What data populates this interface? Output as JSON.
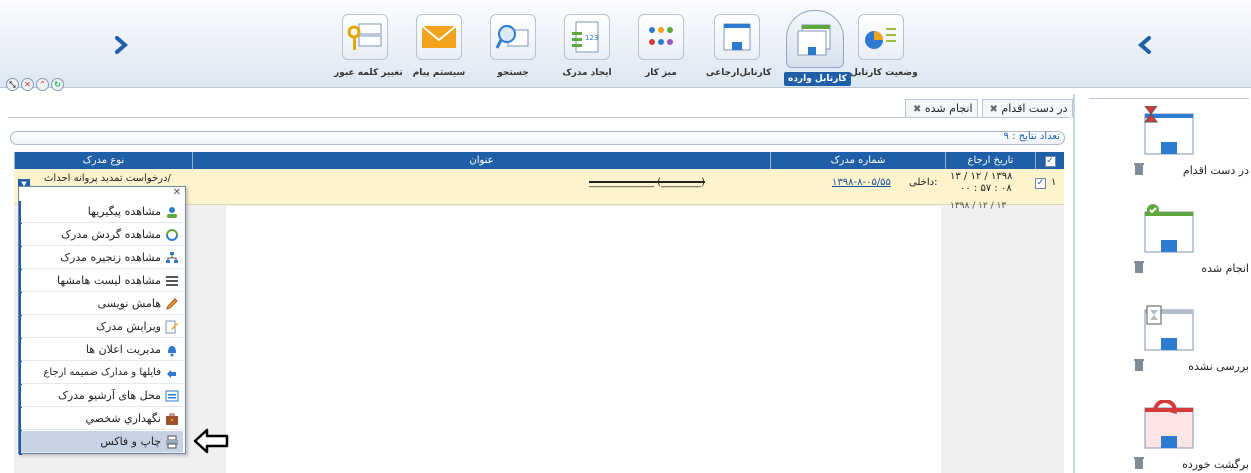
{
  "toolbar": {
    "tools": [
      {
        "id": "workbox-status",
        "label": "وضعیت کارتابل"
      },
      {
        "id": "inbox",
        "label": "کارتابل وارده"
      },
      {
        "id": "referral",
        "label": "کارتابل‌ارجاعی"
      },
      {
        "id": "desk",
        "label": "میز کار"
      },
      {
        "id": "create-doc",
        "label": "ایجاد مدرک"
      },
      {
        "id": "search",
        "label": "جستجو"
      },
      {
        "id": "messages",
        "label": "سیستم پیام"
      },
      {
        "id": "change-password",
        "label": "تغییر کلمه عبور"
      }
    ]
  },
  "sidebar": {
    "folders": [
      {
        "label": "در دست اقدام"
      },
      {
        "label": "انجام شده"
      },
      {
        "label": "بررسی نشده"
      },
      {
        "label": "برگشت خورده"
      }
    ]
  },
  "tabs": [
    {
      "label": "در دست اقدام"
    },
    {
      "label": "انجام شده"
    }
  ],
  "results": {
    "text": "تعداد نتایج : ۹"
  },
  "grid": {
    "headers": {
      "referral_date": "تاریخ ارجاع",
      "doc_number": "شماره مدرک",
      "title": "عنوان",
      "doc_type": "نوع مدرک"
    },
    "rows": [
      {
        "index": "۱",
        "date_line1": "۱۳۹۸ / ۱۲ / ۱۳",
        "date_line2": "۰۸ : ۵۷ : ۰۰",
        "doc_prefix": "داخلی:",
        "doc_number": "۱۳۹۸-۸-۰۵/۵۵",
        "title": "_____________ (________)",
        "doc_type": "درخواست تمدید پروانه احداث/"
      },
      {
        "date_line1": "۱۳۹۸ / ۱۲ / ۱۳"
      }
    ]
  },
  "context_menu": {
    "items": [
      {
        "label": "مشاهده پیگیریها"
      },
      {
        "label": "مشاهده گردش مدرک"
      },
      {
        "label": "مشاهده زنجیره مدرک"
      },
      {
        "label": "مشاهده لیست هامشها"
      },
      {
        "label": "هامش نویسی"
      },
      {
        "label": "ویرایش مدرک"
      },
      {
        "label": "مدیریت اعلان ها"
      },
      {
        "label": "فایلها و مدارک ضمیمه ارجاع"
      },
      {
        "label": "محل های آرشیو مدرک"
      },
      {
        "label": "نگهداري شخصي"
      },
      {
        "label": "چاپ و فاکس"
      }
    ],
    "highlighted_index": 10
  },
  "colors": {
    "accent": "#1e5fa8",
    "row_highlight": "#fdf3cc",
    "menu_highlight": "#c7d3e4"
  }
}
